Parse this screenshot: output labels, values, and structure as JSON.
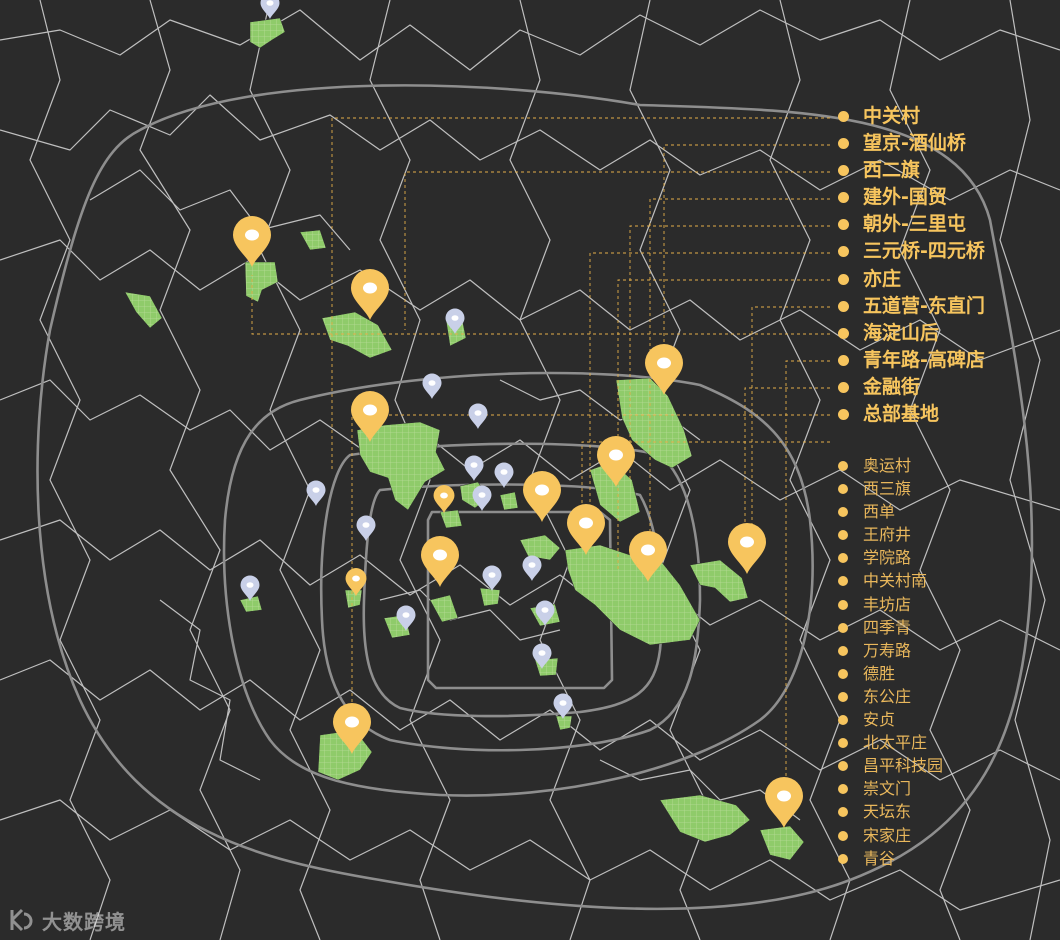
{
  "legend_major": [
    {
      "label": "中关村"
    },
    {
      "label": "望京-酒仙桥"
    },
    {
      "label": "西二旗"
    },
    {
      "label": "建外-国贸"
    },
    {
      "label": "朝外-三里屯"
    },
    {
      "label": "三元桥-四元桥"
    },
    {
      "label": "亦庄"
    },
    {
      "label": "五道营-东直门"
    },
    {
      "label": "海淀山后"
    },
    {
      "label": "青年路-高碑店"
    },
    {
      "label": "金融街"
    },
    {
      "label": "总部基地"
    }
  ],
  "legend_minor": [
    {
      "label": "奥运村"
    },
    {
      "label": "西三旗"
    },
    {
      "label": "西单"
    },
    {
      "label": "王府井"
    },
    {
      "label": "学院路"
    },
    {
      "label": "中关村南"
    },
    {
      "label": "丰坊店"
    },
    {
      "label": "四季青"
    },
    {
      "label": "万寿路"
    },
    {
      "label": "德胜"
    },
    {
      "label": "东公庄"
    },
    {
      "label": "安贞"
    },
    {
      "label": "北太平庄"
    },
    {
      "label": "昌平科技园"
    },
    {
      "label": "崇文门"
    },
    {
      "label": "天坛东"
    },
    {
      "label": "宋家庄"
    },
    {
      "label": "青谷"
    }
  ],
  "logo": {
    "text": "大数跨境",
    "mark": "KDS"
  },
  "colors": {
    "background": "#2b2b2b",
    "district_line": "#d9d9d9",
    "ring_road": "#8e8e8e",
    "area_fill": "#8fcb6a",
    "major_pin": "#f7c55e",
    "minor_pin": "#c9d0e8",
    "leader_line": "#e3ae48"
  },
  "icons": {
    "major": "map-pin-icon-gold",
    "minor": "map-pin-icon-lavender"
  }
}
